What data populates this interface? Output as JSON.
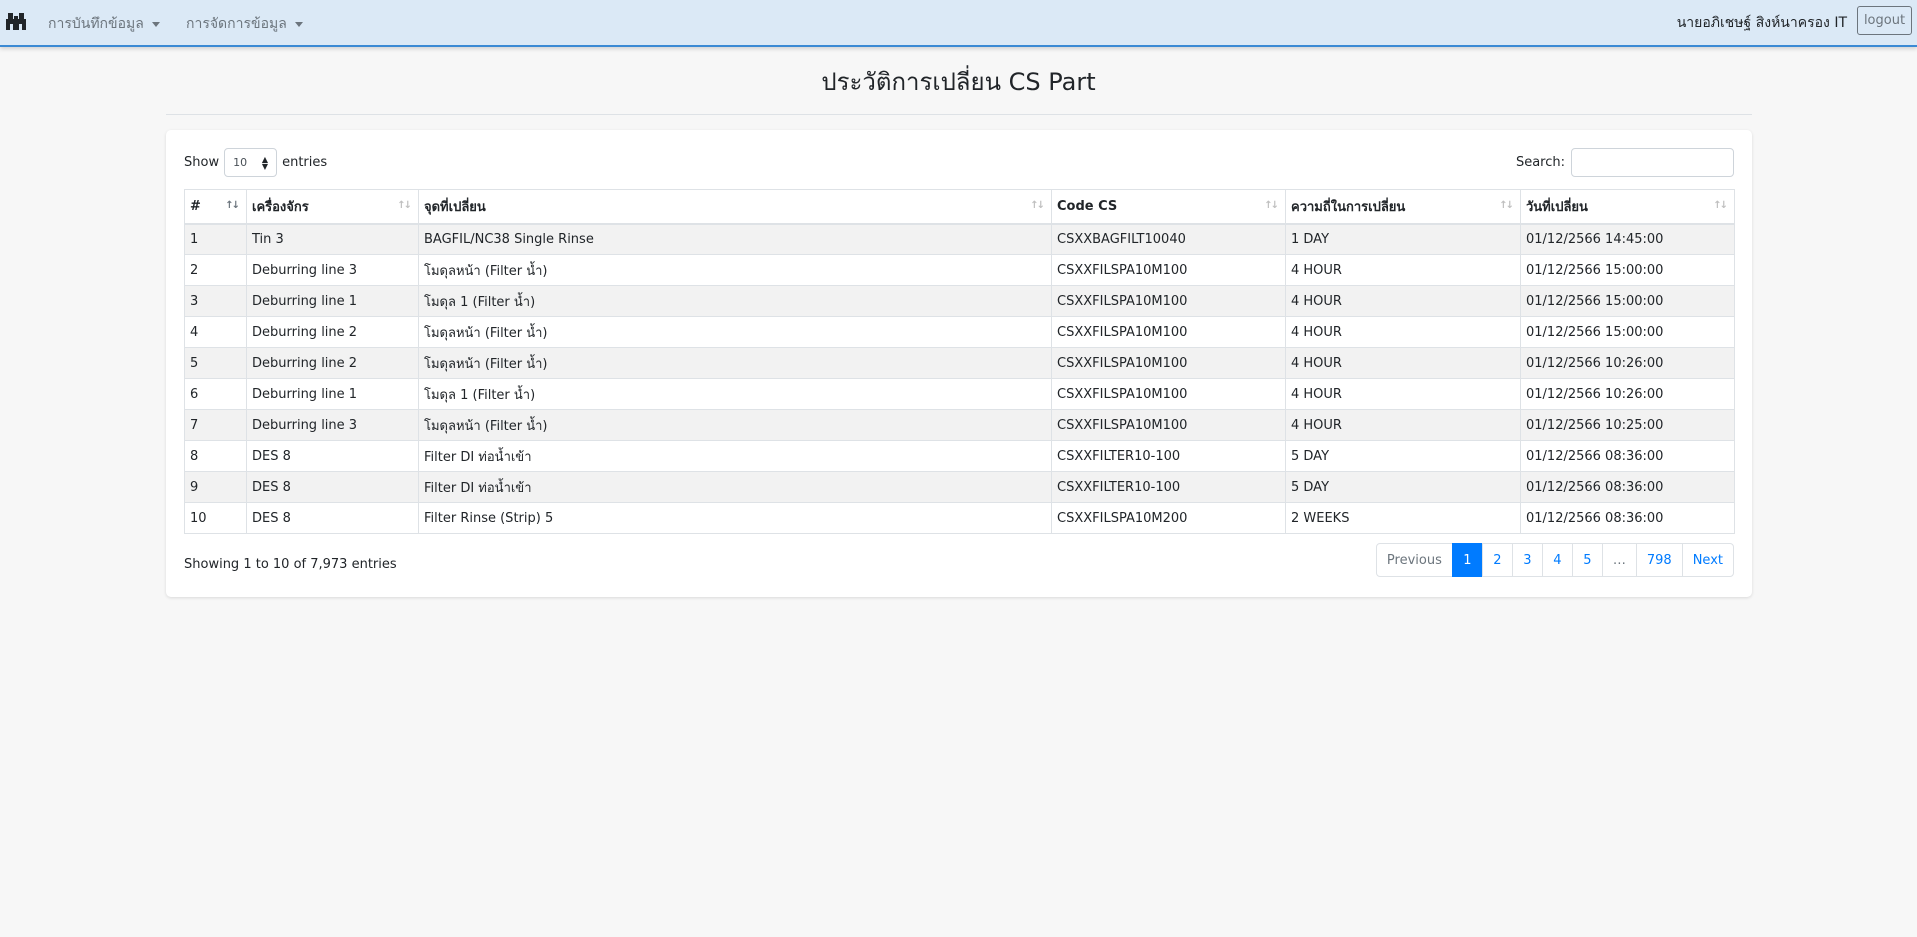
{
  "navbar": {
    "brand_icon": "factory-icon",
    "menu_record": "การบันทึกข้อมูล",
    "menu_manage": "การจัดการข้อมูล",
    "user_name": "นายอภิเชษฐ์ สิงห์นาครอง IT",
    "logout_label": "logout"
  },
  "page": {
    "title": "ประวัติการเปลี่ยน CS Part"
  },
  "controls": {
    "show_label": "Show",
    "page_length": "10",
    "entries_label": "entries",
    "search_label": "Search:",
    "search_value": ""
  },
  "table": {
    "headers": [
      "#",
      "เครื่องจักร",
      "จุดที่เปลี่ยน",
      "Code CS",
      "ความถี่ในการเปลี่ยน",
      "วันที่เปลี่ยน"
    ],
    "rows": [
      [
        "1",
        "Tin 3",
        "BAGFIL/NC38 Single Rinse",
        "CSXXBAGFILT10040",
        "1 DAY",
        "01/12/2566 14:45:00"
      ],
      [
        "2",
        "Deburring line 3",
        "โมดุลหน้า (Filter น้ำ)",
        "CSXXFILSPA10M100",
        "4 HOUR",
        "01/12/2566 15:00:00"
      ],
      [
        "3",
        "Deburring line 1",
        "โมดุล 1 (Filter น้ำ)",
        "CSXXFILSPA10M100",
        "4 HOUR",
        "01/12/2566 15:00:00"
      ],
      [
        "4",
        "Deburring line 2",
        "โมดุลหน้า (Filter น้ำ)",
        "CSXXFILSPA10M100",
        "4 HOUR",
        "01/12/2566 15:00:00"
      ],
      [
        "5",
        "Deburring line 2",
        "โมดุลหน้า (Filter น้ำ)",
        "CSXXFILSPA10M100",
        "4 HOUR",
        "01/12/2566 10:26:00"
      ],
      [
        "6",
        "Deburring line 1",
        "โมดุล 1 (Filter น้ำ)",
        "CSXXFILSPA10M100",
        "4 HOUR",
        "01/12/2566 10:26:00"
      ],
      [
        "7",
        "Deburring line 3",
        "โมดุลหน้า (Filter น้ำ)",
        "CSXXFILSPA10M100",
        "4 HOUR",
        "01/12/2566 10:25:00"
      ],
      [
        "8",
        "DES 8",
        "Filter DI ท่อน้ำเข้า",
        "CSXXFILTER10-100",
        "5 DAY",
        "01/12/2566 08:36:00"
      ],
      [
        "9",
        "DES 8",
        "Filter DI ท่อน้ำเข้า",
        "CSXXFILTER10-100",
        "5 DAY",
        "01/12/2566 08:36:00"
      ],
      [
        "10",
        "DES 8",
        "Filter Rinse (Strip) 5",
        "CSXXFILSPA10M200",
        "2 WEEKS",
        "01/12/2566 08:36:00"
      ]
    ]
  },
  "footer": {
    "info": "Showing 1 to 10 of 7,973 entries",
    "pagination": {
      "previous": "Previous",
      "pages": [
        "1",
        "2",
        "3",
        "4",
        "5",
        "…",
        "798"
      ],
      "next": "Next",
      "current": "1"
    }
  },
  "colors": {
    "navbar_bg": "#dbe9f6",
    "navbar_border": "#3b8ad4",
    "accent": "#007bff",
    "striped_row": "#f2f2f2"
  }
}
